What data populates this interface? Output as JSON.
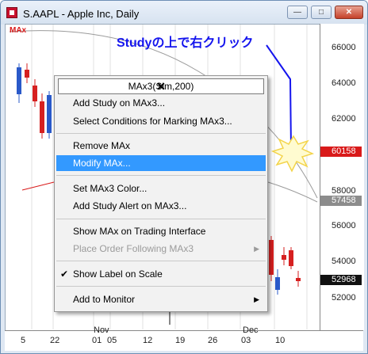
{
  "window": {
    "title": "S.AAPL - Apple Inc, Daily",
    "minimize_label": "—",
    "maximize_label": "□",
    "close_label": "✕"
  },
  "chart": {
    "study_label": "MAx",
    "annotation": "Studyの上で右クリック",
    "price_scale": [
      "66000",
      "64000",
      "62000",
      "58000",
      "56000",
      "54000",
      "52000"
    ],
    "price_labels": {
      "ma": "60158",
      "level": "57458",
      "last": "52968"
    },
    "time_labels": [
      "5",
      "22",
      "01",
      "05",
      "12",
      "19",
      "26",
      "03",
      "10"
    ],
    "month_labels": [
      "Nov",
      "Dec"
    ],
    "colors": {
      "up": "#2a59c9",
      "down": "#d62020",
      "ma_line": "#d91a1a",
      "highlight": "#3399ff"
    }
  },
  "context_menu": {
    "title": "MAx3(Sim,200)",
    "close_label": "✕",
    "items": [
      {
        "label": "Add Study on MAx3..."
      },
      {
        "label": "Select Conditions for Marking MAx3..."
      },
      {
        "label": "Remove MAx"
      },
      {
        "label": "Modify MAx..."
      },
      {
        "label": "Set MAx3 Color..."
      },
      {
        "label": "Add Study Alert on MAx3..."
      },
      {
        "label": "Show MAx on Trading Interface"
      },
      {
        "label": "Place Order Following MAx3"
      },
      {
        "label": "Show Label on Scale",
        "checked": true
      },
      {
        "label": "Add to Monitor"
      }
    ]
  }
}
